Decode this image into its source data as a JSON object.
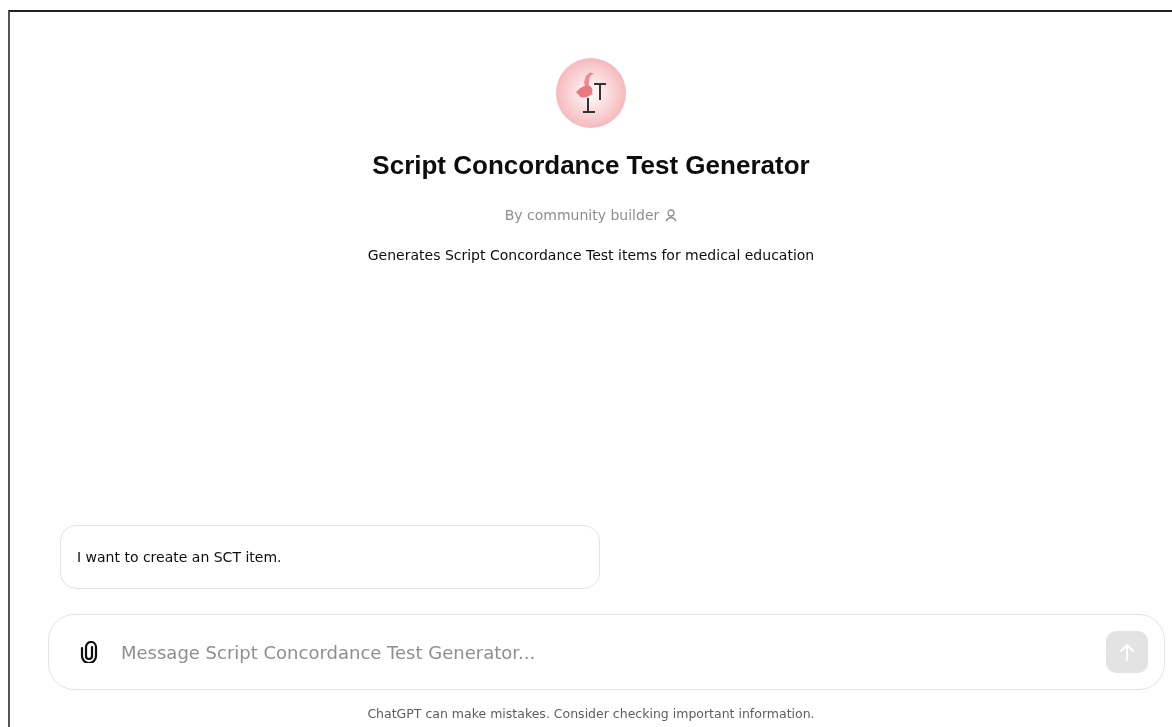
{
  "gpt": {
    "name": "Script Concordance Test Generator",
    "byline": "By community builder",
    "description": "Generates Script Concordance Test items for medical education"
  },
  "starters": [
    {
      "text": "I want to create an SCT item."
    }
  ],
  "composer": {
    "placeholder": "Message Script Concordance Test Generator...",
    "send_disabled": true
  },
  "footer": "ChatGPT can make mistakes. Consider checking important information."
}
